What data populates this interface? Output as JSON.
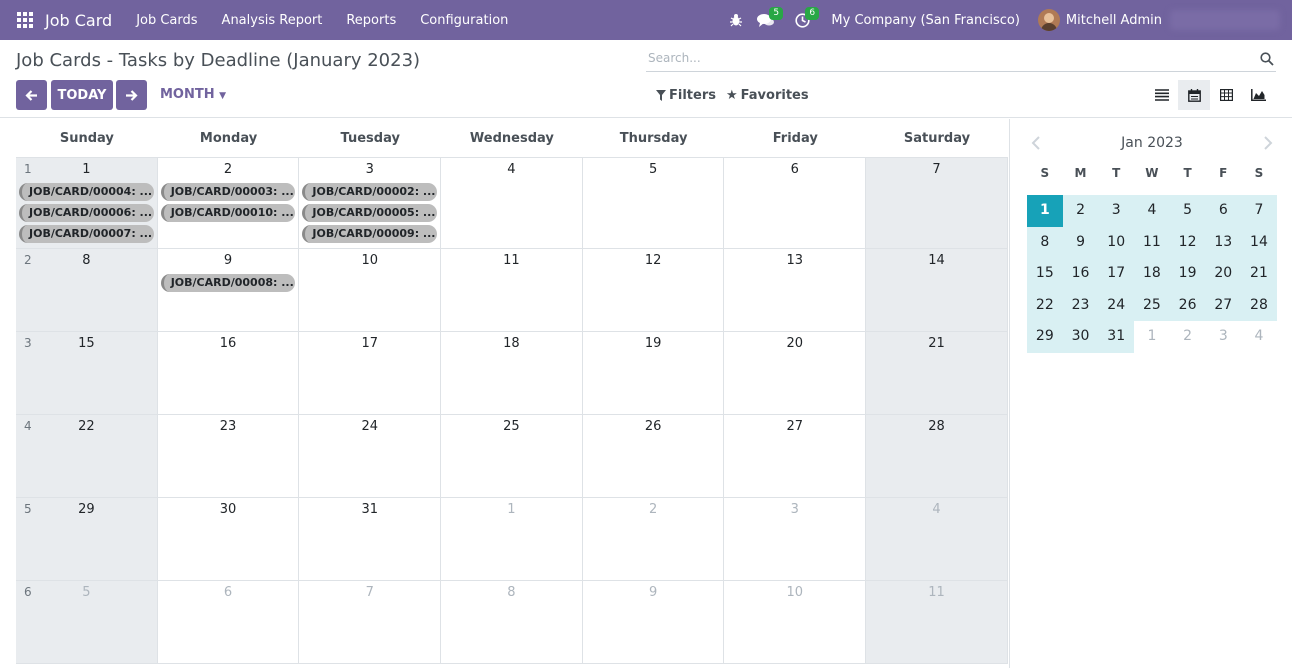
{
  "navbar": {
    "brand": "Job Card",
    "menu": [
      "Job Cards",
      "Analysis Report",
      "Reports",
      "Configuration"
    ],
    "messages_count": "5",
    "activities_count": "6",
    "company": "My Company (San Francisco)",
    "user": "Mitchell Admin"
  },
  "control_panel": {
    "title": "Job Cards - Tasks by Deadline (January 2023)",
    "today_label": "TODAY",
    "scale_label": "MONTH",
    "search_placeholder": "Search...",
    "filters_label": "Filters",
    "favorites_label": "Favorites"
  },
  "calendar": {
    "weekdays": [
      "Sunday",
      "Monday",
      "Tuesday",
      "Wednesday",
      "Thursday",
      "Friday",
      "Saturday"
    ],
    "weeks": [
      {
        "num": "1",
        "days": [
          {
            "d": "1",
            "out": false,
            "events": [
              "JOB/CARD/00004: ...",
              "JOB/CARD/00006: ...",
              "JOB/CARD/00007: ..."
            ]
          },
          {
            "d": "2",
            "out": false,
            "events": [
              "JOB/CARD/00003: ...",
              "JOB/CARD/00010: ..."
            ]
          },
          {
            "d": "3",
            "out": false,
            "events": [
              "JOB/CARD/00002: ...",
              "JOB/CARD/00005: ...",
              "JOB/CARD/00009: ..."
            ]
          },
          {
            "d": "4",
            "out": false,
            "events": []
          },
          {
            "d": "5",
            "out": false,
            "events": []
          },
          {
            "d": "6",
            "out": false,
            "events": []
          },
          {
            "d": "7",
            "out": false,
            "events": []
          }
        ]
      },
      {
        "num": "2",
        "days": [
          {
            "d": "8",
            "out": false,
            "events": []
          },
          {
            "d": "9",
            "out": false,
            "events": [
              "JOB/CARD/00008: ..."
            ]
          },
          {
            "d": "10",
            "out": false,
            "events": []
          },
          {
            "d": "11",
            "out": false,
            "events": []
          },
          {
            "d": "12",
            "out": false,
            "events": []
          },
          {
            "d": "13",
            "out": false,
            "events": []
          },
          {
            "d": "14",
            "out": false,
            "events": []
          }
        ]
      },
      {
        "num": "3",
        "days": [
          {
            "d": "15",
            "out": false,
            "events": []
          },
          {
            "d": "16",
            "out": false,
            "events": []
          },
          {
            "d": "17",
            "out": false,
            "events": []
          },
          {
            "d": "18",
            "out": false,
            "events": []
          },
          {
            "d": "19",
            "out": false,
            "events": []
          },
          {
            "d": "20",
            "out": false,
            "events": []
          },
          {
            "d": "21",
            "out": false,
            "events": []
          }
        ]
      },
      {
        "num": "4",
        "days": [
          {
            "d": "22",
            "out": false,
            "events": []
          },
          {
            "d": "23",
            "out": false,
            "events": []
          },
          {
            "d": "24",
            "out": false,
            "events": []
          },
          {
            "d": "25",
            "out": false,
            "events": []
          },
          {
            "d": "26",
            "out": false,
            "events": []
          },
          {
            "d": "27",
            "out": false,
            "events": []
          },
          {
            "d": "28",
            "out": false,
            "events": []
          }
        ]
      },
      {
        "num": "5",
        "days": [
          {
            "d": "29",
            "out": false,
            "events": []
          },
          {
            "d": "30",
            "out": false,
            "events": []
          },
          {
            "d": "31",
            "out": false,
            "events": []
          },
          {
            "d": "1",
            "out": true,
            "events": []
          },
          {
            "d": "2",
            "out": true,
            "events": []
          },
          {
            "d": "3",
            "out": true,
            "events": []
          },
          {
            "d": "4",
            "out": true,
            "events": []
          }
        ]
      },
      {
        "num": "6",
        "days": [
          {
            "d": "5",
            "out": true,
            "events": []
          },
          {
            "d": "6",
            "out": true,
            "events": []
          },
          {
            "d": "7",
            "out": true,
            "events": []
          },
          {
            "d": "8",
            "out": true,
            "events": []
          },
          {
            "d": "9",
            "out": true,
            "events": []
          },
          {
            "d": "10",
            "out": true,
            "events": []
          },
          {
            "d": "11",
            "out": true,
            "events": []
          }
        ]
      }
    ]
  },
  "mini_calendar": {
    "title": "Jan 2023",
    "dow": [
      "S",
      "M",
      "T",
      "W",
      "T",
      "F",
      "S"
    ],
    "today": "1",
    "rows": [
      [
        {
          "d": "1"
        },
        {
          "d": "2"
        },
        {
          "d": "3"
        },
        {
          "d": "4"
        },
        {
          "d": "5"
        },
        {
          "d": "6"
        },
        {
          "d": "7"
        }
      ],
      [
        {
          "d": "8"
        },
        {
          "d": "9"
        },
        {
          "d": "10"
        },
        {
          "d": "11"
        },
        {
          "d": "12"
        },
        {
          "d": "13"
        },
        {
          "d": "14"
        }
      ],
      [
        {
          "d": "15"
        },
        {
          "d": "16"
        },
        {
          "d": "17"
        },
        {
          "d": "18"
        },
        {
          "d": "19"
        },
        {
          "d": "20"
        },
        {
          "d": "21"
        }
      ],
      [
        {
          "d": "22"
        },
        {
          "d": "23"
        },
        {
          "d": "24"
        },
        {
          "d": "25"
        },
        {
          "d": "26"
        },
        {
          "d": "27"
        },
        {
          "d": "28"
        }
      ],
      [
        {
          "d": "29"
        },
        {
          "d": "30"
        },
        {
          "d": "31"
        },
        {
          "d": "1",
          "out": true
        },
        {
          "d": "2",
          "out": true
        },
        {
          "d": "3",
          "out": true
        },
        {
          "d": "4",
          "out": true
        }
      ]
    ]
  },
  "colors": {
    "brand": "#71639e",
    "event_bg": "#bdbdbd",
    "mini_today": "#17a2b8",
    "mini_range": "#d9f0f3",
    "badge": "#28a745"
  }
}
